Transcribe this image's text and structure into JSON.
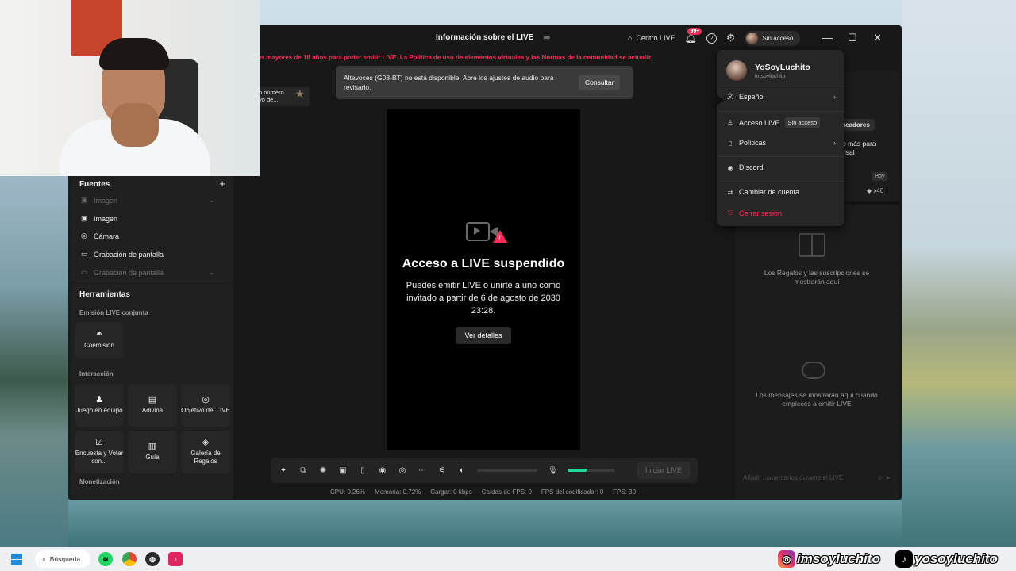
{
  "window": {
    "title": "Información sobre el LIVE",
    "centro_live": "Centro LIVE",
    "notif_badge": "99+",
    "access_label": "Sin acceso"
  },
  "warning_strip": "los creadores deben ser mayores de 18 años para poder emitir LIVE. La Política de uso de elementos virtuales y las Normas de la comunidad se actualiz",
  "toast": {
    "text": "Altavoces (G08-BT) no está disponible. Abre los ajustes de audio para revisarlo.",
    "button": "Consultar"
  },
  "snippet": {
    "line1": "n número",
    "line2": "vo de..."
  },
  "sources": {
    "title": "Fuentes",
    "items": [
      {
        "label": "Imagen",
        "dim": true
      },
      {
        "label": "Imagen",
        "dim": false
      },
      {
        "label": "Cámara",
        "dim": false
      },
      {
        "label": "Grabación de pantalla",
        "dim": false
      },
      {
        "label": "Grabación de pantalla",
        "dim": true
      }
    ]
  },
  "tools": {
    "title": "Herramientas",
    "emision_title": "Emisión LIVE conjunta",
    "coemision": "Coemisión",
    "interaccion_title": "Interacción",
    "items": [
      "Juego en equipo",
      "Adivina",
      "Objetivo del LIVE",
      "Encuesta y Votar con...",
      "Guía",
      "Galería de Regalos"
    ],
    "monetizacion_title": "Monetización"
  },
  "stage": {
    "title": "Acceso a LIVE suspendido",
    "text": "Puedes emitir LIVE o unirte a uno como invitado a partir de 6 de agosto de 2030 23:28.",
    "button": "Ver detalles"
  },
  "bottom_bar": {
    "start_live": "Iniciar LIVE",
    "mic_level": 0.4
  },
  "stats": {
    "cpu": "CPU:  0.26%",
    "memoria": "Memoria:  0.72%",
    "cargar": "Cargar:  0 kbps",
    "caidas": "Caídas de FPS:  0",
    "fps_codificador": "FPS del codificador:  0",
    "fps": "FPS:  30"
  },
  "right_panel": {
    "creators_button": "readores",
    "promo_line1": "o más para",
    "promo_line2": "nsal",
    "today": "Hoy",
    "count": "x40",
    "gifts_msg": "Los Regalos y las suscripciones se mostrarán aquí",
    "messages_msg": "Los mensajes se mostrarán aquí cuando empieces a emitir LIVE",
    "comment_placeholder": "Añadir comentarios durante el LIVE"
  },
  "menu": {
    "name": "YoSoyLuchito",
    "handle": "imsoyluchito",
    "items": {
      "language": "Español",
      "live_access": "Acceso LIVE",
      "live_access_badge": "Sin acceso",
      "policies": "Políticas",
      "discord": "Discord",
      "switch_account": "Cambiar de cuenta",
      "logout": "Cerrar sesión"
    }
  },
  "taskbar": {
    "search": "Búsqueda"
  },
  "branding": {
    "instagram": "imsoyluchito",
    "tiktok": "yosoyluchito"
  },
  "colors": {
    "accent": "#fe2c55",
    "mic_level": "#1fdb9b",
    "panel": "#181818"
  }
}
